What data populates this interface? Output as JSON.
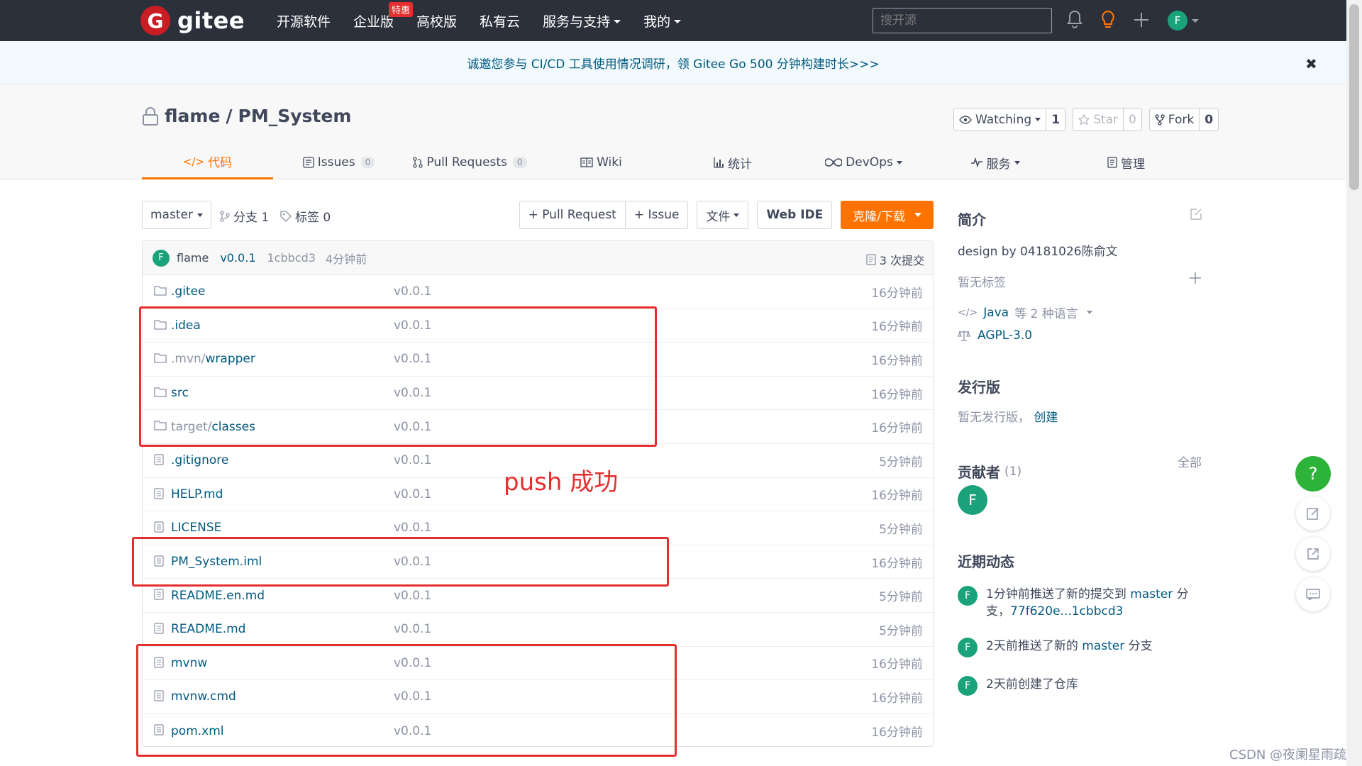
{
  "topnav": {
    "logo_text": "gitee",
    "items": [
      {
        "label": "开源软件"
      },
      {
        "label": "企业版",
        "badge": "特惠"
      },
      {
        "label": "高校版"
      },
      {
        "label": "私有云"
      },
      {
        "label": "服务与支持",
        "dropdown": true
      },
      {
        "label": "我的",
        "dropdown": true
      }
    ],
    "search_placeholder": "搜开源",
    "avatar": "F"
  },
  "banner": {
    "text": "诚邀您参与 CI/CD 工具使用情况调研，领 Gitee Go 500 分钟构建时长>>>",
    "close": "✖"
  },
  "repo": {
    "owner": "flame",
    "separator": "/",
    "name": "PM_System",
    "watch_label": "Watching",
    "watch_count": "1",
    "star_label": "Star",
    "star_count": "0",
    "fork_label": "Fork",
    "fork_count": "0"
  },
  "tabs": [
    {
      "label": "代码",
      "icon": "code-icon"
    },
    {
      "label": "Issues",
      "count": "0",
      "icon": "issues-icon"
    },
    {
      "label": "Pull Requests",
      "count": "0",
      "icon": "pull-request-icon"
    },
    {
      "label": "Wiki",
      "icon": "wiki-icon"
    },
    {
      "label": "统计",
      "icon": "stats-icon"
    },
    {
      "label": "DevOps",
      "icon": "devops-icon"
    },
    {
      "label": "服务",
      "icon": "service-icon"
    },
    {
      "label": "管理",
      "icon": "manage-icon"
    }
  ],
  "toolbar": {
    "branch": "master",
    "branches": "分支 1",
    "tags": "标签 0",
    "pull_request": "+ Pull Request",
    "issue": "+ Issue",
    "file": "文件",
    "web_ide": "Web IDE",
    "clone": "克隆/下载"
  },
  "commit": {
    "avatar": "F",
    "author": "flame",
    "version": "v0.0.1",
    "hash": "1cbbcd3",
    "time": "4分钟前",
    "count": "3 次提交"
  },
  "files": [
    {
      "type": "folder",
      "name": ".gitee",
      "commit": "v0.0.1",
      "time": "16分钟前"
    },
    {
      "type": "folder",
      "name": ".idea",
      "commit": "v0.0.1",
      "time": "16分钟前"
    },
    {
      "type": "folder",
      "name": ".mvn/",
      "name2": "wrapper",
      "commit": "v0.0.1",
      "time": "16分钟前"
    },
    {
      "type": "folder",
      "name": "src",
      "commit": "v0.0.1",
      "time": "16分钟前"
    },
    {
      "type": "folder",
      "name": "target/",
      "name2": "classes",
      "commit": "v0.0.1",
      "time": "16分钟前"
    },
    {
      "type": "file",
      "name": ".gitignore",
      "commit": "v0.0.1",
      "time": "5分钟前"
    },
    {
      "type": "file",
      "name": "HELP.md",
      "commit": "v0.0.1",
      "time": "16分钟前"
    },
    {
      "type": "file",
      "name": "LICENSE",
      "commit": "v0.0.1",
      "time": "5分钟前"
    },
    {
      "type": "file",
      "name": "PM_System.iml",
      "commit": "v0.0.1",
      "time": "16分钟前"
    },
    {
      "type": "file",
      "name": "README.en.md",
      "commit": "v0.0.1",
      "time": "5分钟前"
    },
    {
      "type": "file",
      "name": "README.md",
      "commit": "v0.0.1",
      "time": "5分钟前"
    },
    {
      "type": "file",
      "name": "mvnw",
      "commit": "v0.0.1",
      "time": "16分钟前"
    },
    {
      "type": "file",
      "name": "mvnw.cmd",
      "commit": "v0.0.1",
      "time": "16分钟前"
    },
    {
      "type": "file",
      "name": "pom.xml",
      "commit": "v0.0.1",
      "time": "16分钟前"
    }
  ],
  "annotation": {
    "text": "push 成功",
    "color": "#e52e2e"
  },
  "sidebar": {
    "intro_title": "简介",
    "description": "design by 04181026陈俞文",
    "no_tags": "暂无标签",
    "language": "Java",
    "language_more": "等 2 种语言",
    "license": "AGPL-3.0",
    "release_title": "发行版",
    "no_release": "暂无发行版，",
    "create": "创建",
    "contributors_title": "贡献者",
    "contributors_count": "(1)",
    "all": "全部",
    "contributor_avatar": "F",
    "activity_title": "近期动态",
    "activities": [
      {
        "pre": "1分钟前推送了新的提交到 ",
        "branch": "master",
        "post": " 分支，",
        "link": "77f620e...1cbbcd3"
      },
      {
        "pre": "2天前推送了新的 ",
        "branch": "master",
        "post": " 分支",
        "link": ""
      },
      {
        "pre": "2天前创建了仓库",
        "branch": "",
        "post": "",
        "link": ""
      }
    ]
  },
  "fab": {
    "help": "?"
  },
  "watermark": "CSDN @夜阑星雨疏",
  "colors": {
    "nav_bg": "#2b303b",
    "accent": "#fe7300",
    "link": "#005980",
    "avatar": "#1aa37a",
    "brand": "#c71d23"
  }
}
